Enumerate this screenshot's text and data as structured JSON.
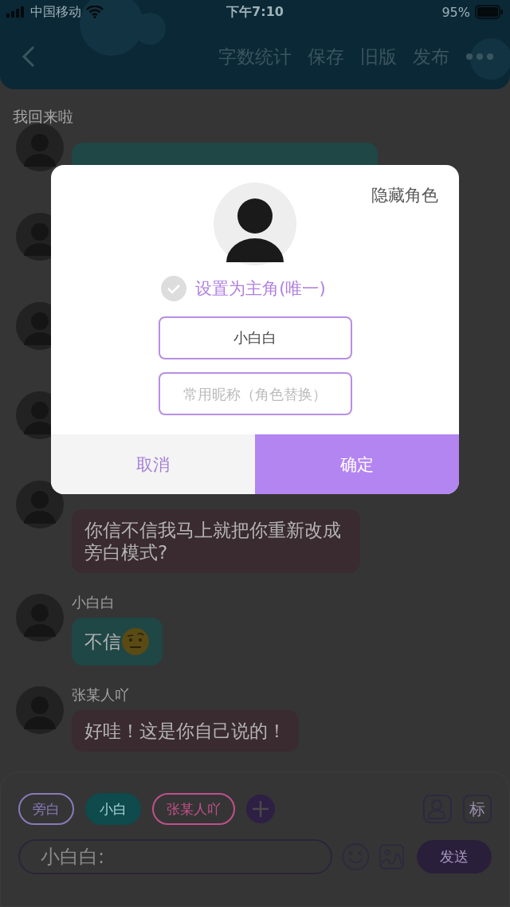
{
  "status_bar": {
    "carrier": "中国移动",
    "time": "下午7:10",
    "battery": "95%"
  },
  "header": {
    "actions": [
      "字数统计",
      "保存",
      "旧版",
      "发布"
    ]
  },
  "title": "我回来啦",
  "messages": [
    {
      "text": "你信不信我马上就把你重新改成旁白模式?",
      "color": "#3a2b30"
    },
    {
      "name": "小白白",
      "text": "不信",
      "emoji": true,
      "color": "#1f4745"
    },
    {
      "name": "张某人吖",
      "text": "好哇！这是你自己说的！",
      "emoji": false,
      "color": "#3a2b30"
    }
  ],
  "roles": [
    {
      "label": "旁白",
      "selected": false,
      "color": "#8a7ab8"
    },
    {
      "label": "小白",
      "selected": true,
      "color": "#0f4a4c"
    },
    {
      "label": "张某人吖",
      "selected": false,
      "color": "#c0508a"
    }
  ],
  "tool_label": "标",
  "composer": {
    "placeholder": "小白白:",
    "send": "发送"
  },
  "dialog": {
    "hide": "隐藏角色",
    "main_role": {
      "label": "设置为主角(唯一)",
      "checked": false
    },
    "name_value": "小白白",
    "nickname_placeholder": "常用昵称（角色替换）",
    "cancel": "取消",
    "confirm": "确定"
  }
}
